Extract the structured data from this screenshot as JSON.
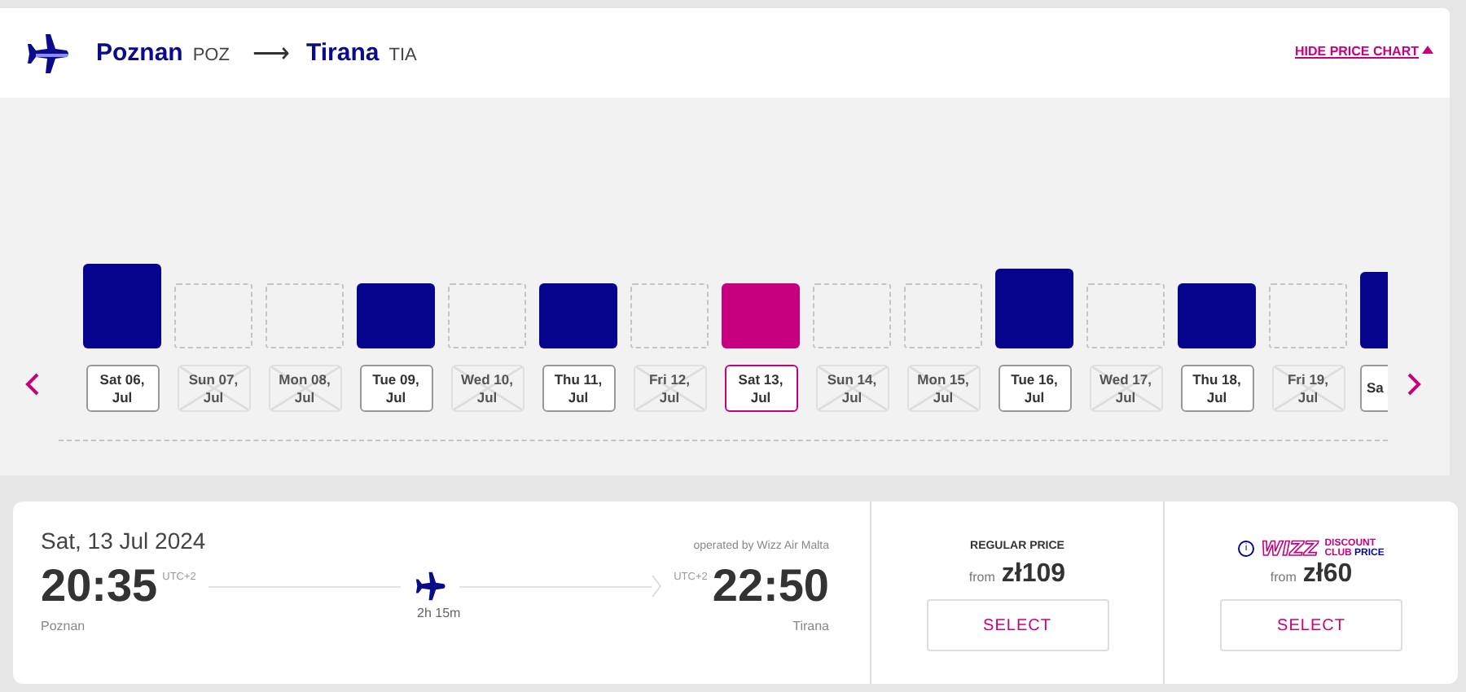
{
  "route": {
    "origin": {
      "city": "Poznan",
      "code": "POZ"
    },
    "arrow": "⟶",
    "destination": {
      "city": "Tirana",
      "code": "TIA"
    },
    "toggle": "HIDE PRICE CHART"
  },
  "price_chart": {
    "days": [
      {
        "day": "Sat 06,",
        "month": "Jul",
        "available": true,
        "selected": false,
        "kind": "tallest"
      },
      {
        "day": "Sun 07,",
        "month": "Jul",
        "available": false,
        "selected": false
      },
      {
        "day": "Mon 08,",
        "month": "Jul",
        "available": false,
        "selected": false
      },
      {
        "day": "Tue 09,",
        "month": "Jul",
        "available": true,
        "selected": false,
        "kind": "short"
      },
      {
        "day": "Wed 10,",
        "month": "Jul",
        "available": false,
        "selected": false
      },
      {
        "day": "Thu 11,",
        "month": "Jul",
        "available": true,
        "selected": false,
        "kind": "short"
      },
      {
        "day": "Fri 12,",
        "month": "Jul",
        "available": false,
        "selected": false
      },
      {
        "day": "Sat 13,",
        "month": "Jul",
        "available": true,
        "selected": true,
        "kind": "short"
      },
      {
        "day": "Sun 14,",
        "month": "Jul",
        "available": false,
        "selected": false
      },
      {
        "day": "Mon 15,",
        "month": "Jul",
        "available": false,
        "selected": false
      },
      {
        "day": "Tue 16,",
        "month": "Jul",
        "available": true,
        "selected": false,
        "kind": "tall"
      },
      {
        "day": "Wed 17,",
        "month": "Jul",
        "available": false,
        "selected": false
      },
      {
        "day": "Thu 18,",
        "month": "Jul",
        "available": true,
        "selected": false,
        "kind": "short"
      },
      {
        "day": "Fri 19,",
        "month": "Jul",
        "available": false,
        "selected": false
      },
      {
        "day": "Sa",
        "available": true,
        "selected": false,
        "kind": "medium"
      }
    ]
  },
  "flight": {
    "date": "Sat, 13 Jul 2024",
    "operator": "operated by Wizz Air Malta",
    "departure": {
      "time": "20:35",
      "zone": "UTC+2",
      "city": "Poznan"
    },
    "duration": "2h 15m",
    "arrival": {
      "time": "22:50",
      "zone": "UTC+2",
      "city": "Tirana"
    }
  },
  "fares": [
    {
      "kind": "regular",
      "title": "REGULAR PRICE",
      "from": "from",
      "price": "zł109",
      "button": "SELECT"
    },
    {
      "kind": "club",
      "info": "i",
      "logo": "WIZZ",
      "title_lines": [
        "DISCOUNT",
        "CLUB",
        "PRICE"
      ],
      "from": "from",
      "price": "zł60",
      "button": "SELECT"
    }
  ]
}
